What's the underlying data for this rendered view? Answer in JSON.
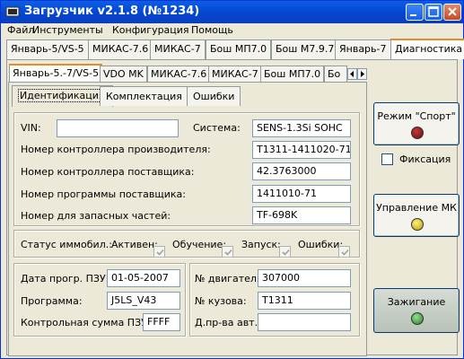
{
  "window": {
    "title": "Загрузчик v2.1.8 (№1234)"
  },
  "menu": [
    "Файл",
    "Инструменты",
    "Конфигурация",
    "Помощь"
  ],
  "main_tabs": [
    "Январь-5/VS-5",
    "МИКАС-7.6",
    "МИКАС-7",
    "Бош МП7.0",
    "Бош М7.9.7",
    "Январь-7",
    "Диагностика"
  ],
  "sub_tabs": [
    "Январь-5.-7/VS-5",
    "VDO MK",
    "МИКАС-7.6",
    "МИКАС-7",
    "Бош МП7.0",
    "Бо"
  ],
  "inner_tabs": [
    "Идентификация",
    "Комплектация",
    "Ошибки"
  ],
  "ident": {
    "vin_label": "VIN:",
    "vin_value": "",
    "system_label": "Система:",
    "system_value": "SENS-1.3Si SOHC",
    "rows": [
      {
        "label": "Номер контроллера производителя:",
        "value": "T1311-1411020-71"
      },
      {
        "label": "Номер контроллера поставщика:",
        "value": "42.3763000"
      },
      {
        "label": "Номер программы поставщика:",
        "value": "1411010-71"
      },
      {
        "label": "Номер для запасных частей:",
        "value": "TF-698K"
      }
    ]
  },
  "immo": {
    "label": "Статус иммобил.:",
    "flags": [
      {
        "label": "Активен:",
        "checked": true
      },
      {
        "label": "Обучение:",
        "checked": true
      },
      {
        "label": "Запуск:",
        "checked": true
      },
      {
        "label": "Ошибки:",
        "checked": true
      }
    ]
  },
  "bottom": {
    "left": [
      {
        "label": "Дата прогр. ПЗУ:",
        "value": "01-05-2007"
      },
      {
        "label": "Программа:",
        "value": "J5LS_V43"
      },
      {
        "label": "Контрольная сумма ПЗУ:",
        "value": "FFFF"
      }
    ],
    "right": [
      {
        "label": "№ двигателя:",
        "value": "307000"
      },
      {
        "label": "№ кузова:",
        "value": "T1311"
      },
      {
        "label": "Д.пр-ва авт.:",
        "value": ""
      }
    ]
  },
  "right_panel": {
    "sport_mode_label": "Режим \"Спорт\"",
    "fix_label": "Фиксация",
    "mk_control_label": "Управление МК",
    "ignition_label": "Зажигание"
  },
  "colors": {
    "lamp_sport": "#7a1010",
    "lamp_mk": "#d9c400",
    "lamp_ignition": "#3a9a3a"
  }
}
